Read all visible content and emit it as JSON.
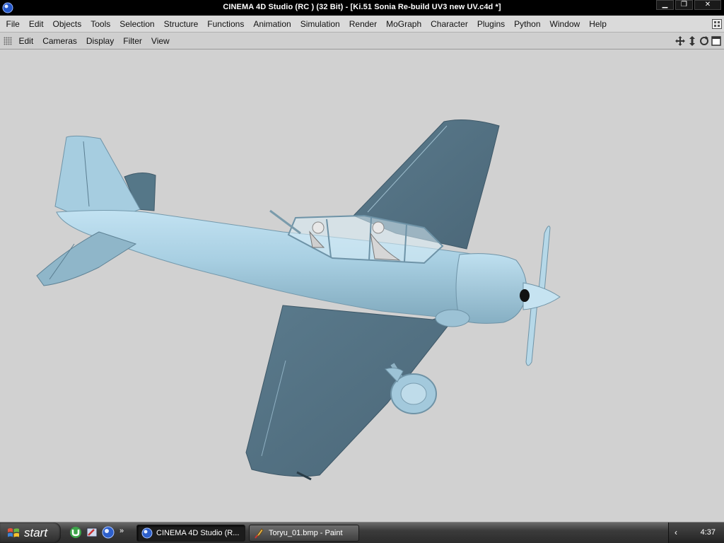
{
  "window": {
    "title": "CINEMA 4D Studio (RC ) (32 Bit) - [Ki.51 Sonia Re-build UV3 new UV.c4d *]",
    "controls": {
      "minimize": "▁",
      "restore": "❐",
      "close": "✕"
    }
  },
  "menubar": {
    "items": [
      "File",
      "Edit",
      "Objects",
      "Tools",
      "Selection",
      "Structure",
      "Functions",
      "Animation",
      "Simulation",
      "Render",
      "MoGraph",
      "Character",
      "Plugins",
      "Python",
      "Window",
      "Help"
    ]
  },
  "viewport_menu": {
    "items": [
      "Edit",
      "Cameras",
      "Display",
      "Filter",
      "View"
    ],
    "nav_icons": [
      "move-view-icon",
      "zoom-view-icon",
      "rotate-view-icon",
      "toggle-panels-icon"
    ]
  },
  "taskbar": {
    "start_label": "start",
    "quicklaunch_icons": [
      "utorrent-icon",
      "paint-brush-icon",
      "cinema4d-icon"
    ],
    "more_label": "»",
    "tasks": [
      {
        "label": "CINEMA 4D Studio (R...",
        "icon": "cinema4d-icon",
        "active": true
      },
      {
        "label": "Toryu_01.bmp - Paint",
        "icon": "paint-icon",
        "active": false
      }
    ],
    "tray_arrow": "‹",
    "clock": "4:37"
  },
  "colors": {
    "viewport_bg": "#d1d1d1",
    "model_light": "#a9d0e3",
    "model_mid": "#8fb7cb",
    "model_dark": "#587789",
    "titlebar": "#000000",
    "menubar": "#dadada"
  }
}
